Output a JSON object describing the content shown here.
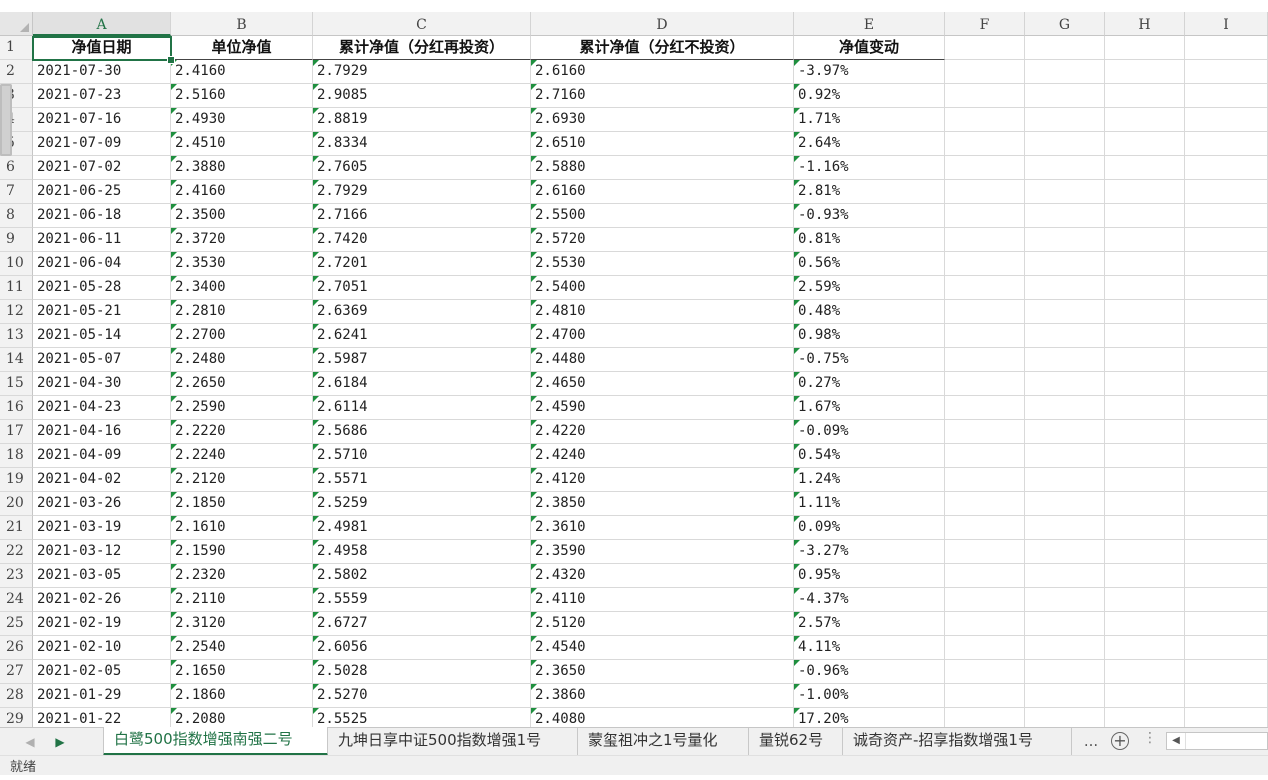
{
  "columns": [
    "A",
    "B",
    "C",
    "D",
    "E",
    "F",
    "G",
    "H",
    "I"
  ],
  "header": [
    "净值日期",
    "单位净值",
    "累计净值（分红再投资）",
    "累计净值（分红不投资）",
    "净值变动"
  ],
  "rows": [
    [
      "2021-07-30",
      "2.4160",
      "2.7929",
      "2.6160",
      "-3.97%"
    ],
    [
      "2021-07-23",
      "2.5160",
      "2.9085",
      "2.7160",
      "0.92%"
    ],
    [
      "2021-07-16",
      "2.4930",
      "2.8819",
      "2.6930",
      "1.71%"
    ],
    [
      "2021-07-09",
      "2.4510",
      "2.8334",
      "2.6510",
      "2.64%"
    ],
    [
      "2021-07-02",
      "2.3880",
      "2.7605",
      "2.5880",
      "-1.16%"
    ],
    [
      "2021-06-25",
      "2.4160",
      "2.7929",
      "2.6160",
      "2.81%"
    ],
    [
      "2021-06-18",
      "2.3500",
      "2.7166",
      "2.5500",
      "-0.93%"
    ],
    [
      "2021-06-11",
      "2.3720",
      "2.7420",
      "2.5720",
      "0.81%"
    ],
    [
      "2021-06-04",
      "2.3530",
      "2.7201",
      "2.5530",
      "0.56%"
    ],
    [
      "2021-05-28",
      "2.3400",
      "2.7051",
      "2.5400",
      "2.59%"
    ],
    [
      "2021-05-21",
      "2.2810",
      "2.6369",
      "2.4810",
      "0.48%"
    ],
    [
      "2021-05-14",
      "2.2700",
      "2.6241",
      "2.4700",
      "0.98%"
    ],
    [
      "2021-05-07",
      "2.2480",
      "2.5987",
      "2.4480",
      "-0.75%"
    ],
    [
      "2021-04-30",
      "2.2650",
      "2.6184",
      "2.4650",
      "0.27%"
    ],
    [
      "2021-04-23",
      "2.2590",
      "2.6114",
      "2.4590",
      "1.67%"
    ],
    [
      "2021-04-16",
      "2.2220",
      "2.5686",
      "2.4220",
      "-0.09%"
    ],
    [
      "2021-04-09",
      "2.2240",
      "2.5710",
      "2.4240",
      "0.54%"
    ],
    [
      "2021-04-02",
      "2.2120",
      "2.5571",
      "2.4120",
      "1.24%"
    ],
    [
      "2021-03-26",
      "2.1850",
      "2.5259",
      "2.3850",
      "1.11%"
    ],
    [
      "2021-03-19",
      "2.1610",
      "2.4981",
      "2.3610",
      "0.09%"
    ],
    [
      "2021-03-12",
      "2.1590",
      "2.4958",
      "2.3590",
      "-3.27%"
    ],
    [
      "2021-03-05",
      "2.2320",
      "2.5802",
      "2.4320",
      "0.95%"
    ],
    [
      "2021-02-26",
      "2.2110",
      "2.5559",
      "2.4110",
      "-4.37%"
    ],
    [
      "2021-02-19",
      "2.3120",
      "2.6727",
      "2.5120",
      "2.57%"
    ],
    [
      "2021-02-10",
      "2.2540",
      "2.6056",
      "2.4540",
      "4.11%"
    ],
    [
      "2021-02-05",
      "2.1650",
      "2.5028",
      "2.3650",
      "-0.96%"
    ],
    [
      "2021-01-29",
      "2.1860",
      "2.5270",
      "2.3860",
      "-1.00%"
    ],
    [
      "2021-01-22",
      "2.2080",
      "2.5525",
      "2.4080",
      "17.20%"
    ]
  ],
  "sheet_tabs": [
    "白鹭500指数增强南强二号",
    "九坤日享中证500指数增强1号",
    "蒙玺祖冲之1号量化",
    "量锐62号",
    "诚奇资产-招享指数增强1号"
  ],
  "active_tab_index": 0,
  "tab_more": "...",
  "add_sheet": "+",
  "status": "就绪",
  "colors": {
    "accent": "#217346",
    "text_marker": "#1f8f3f",
    "gridline": "#d9d9d9"
  }
}
